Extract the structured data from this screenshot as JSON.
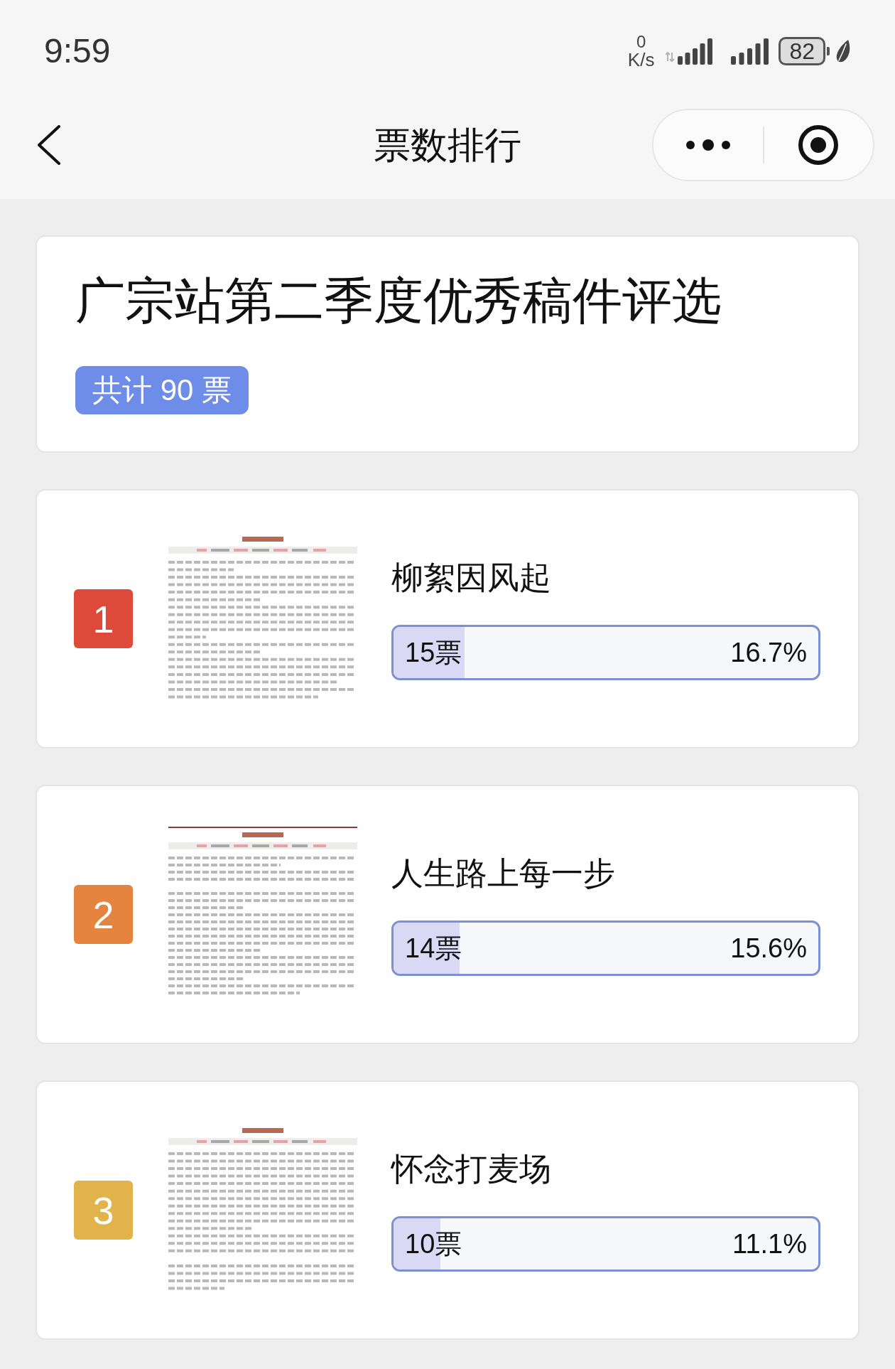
{
  "status_bar": {
    "time": "9:59",
    "network_speed": {
      "value": "0",
      "unit": "K/s"
    },
    "battery": "82"
  },
  "nav_bar": {
    "title": "票数排行"
  },
  "poll": {
    "title": "广宗站第二季度优秀稿件评选",
    "total": "共计 90 票"
  },
  "entries": [
    {
      "rank": "1",
      "color": "#de4a3a",
      "title": "柳絮因风起",
      "votes": "15票",
      "percent": "16.7%",
      "level": 0.167
    },
    {
      "rank": "2",
      "color": "#e5843f",
      "title": "人生路上每一步",
      "votes": "14票",
      "percent": "15.6%",
      "level": 0.156
    },
    {
      "rank": "3",
      "color": "#e2b24b",
      "title": "怀念打麦场",
      "votes": "10票",
      "percent": "11.1%",
      "level": 0.111
    }
  ]
}
